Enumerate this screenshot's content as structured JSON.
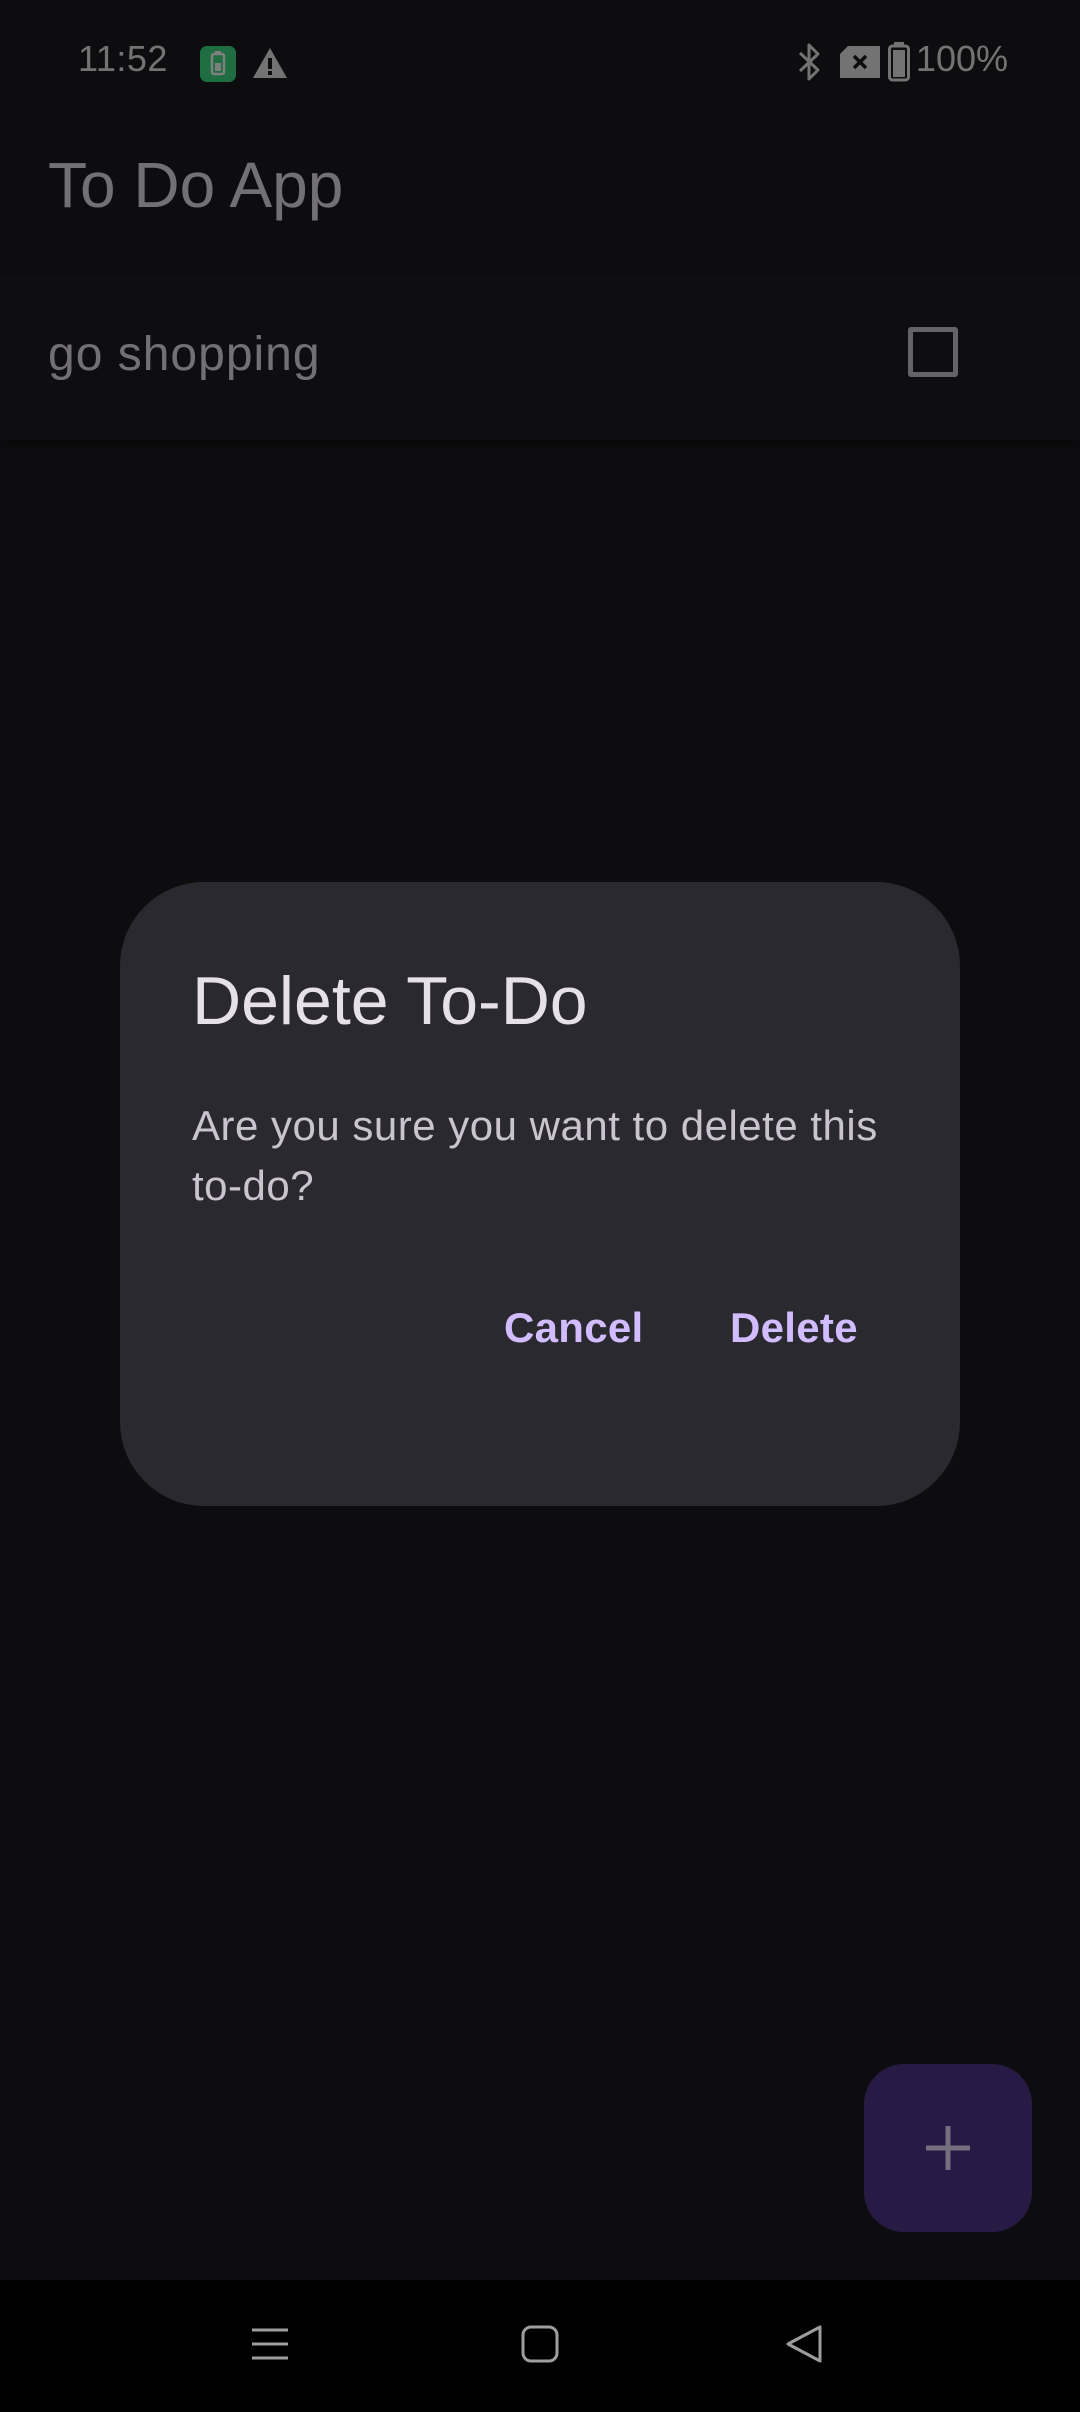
{
  "status_bar": {
    "time": "11:52",
    "battery_percent": "100%",
    "icons": [
      "battery-saver-icon",
      "warning-icon",
      "bluetooth-icon",
      "no-sim-icon",
      "battery-icon"
    ]
  },
  "app": {
    "title": "To Do App"
  },
  "todos": [
    {
      "text": "go shopping",
      "checked": false
    }
  ],
  "dialog": {
    "title": "Delete To-Do",
    "message": "Are you sure you want to delete this to-do?",
    "cancel_label": "Cancel",
    "delete_label": "Delete"
  },
  "fab": {
    "icon": "plus-icon"
  },
  "nav_bar": {
    "icons": [
      "menu-icon",
      "home-icon",
      "back-icon"
    ]
  },
  "colors": {
    "background": "#1a1a1f",
    "dialog_surface": "#2b2930",
    "accent": "#d0bcff",
    "fab": "#4f378b"
  }
}
